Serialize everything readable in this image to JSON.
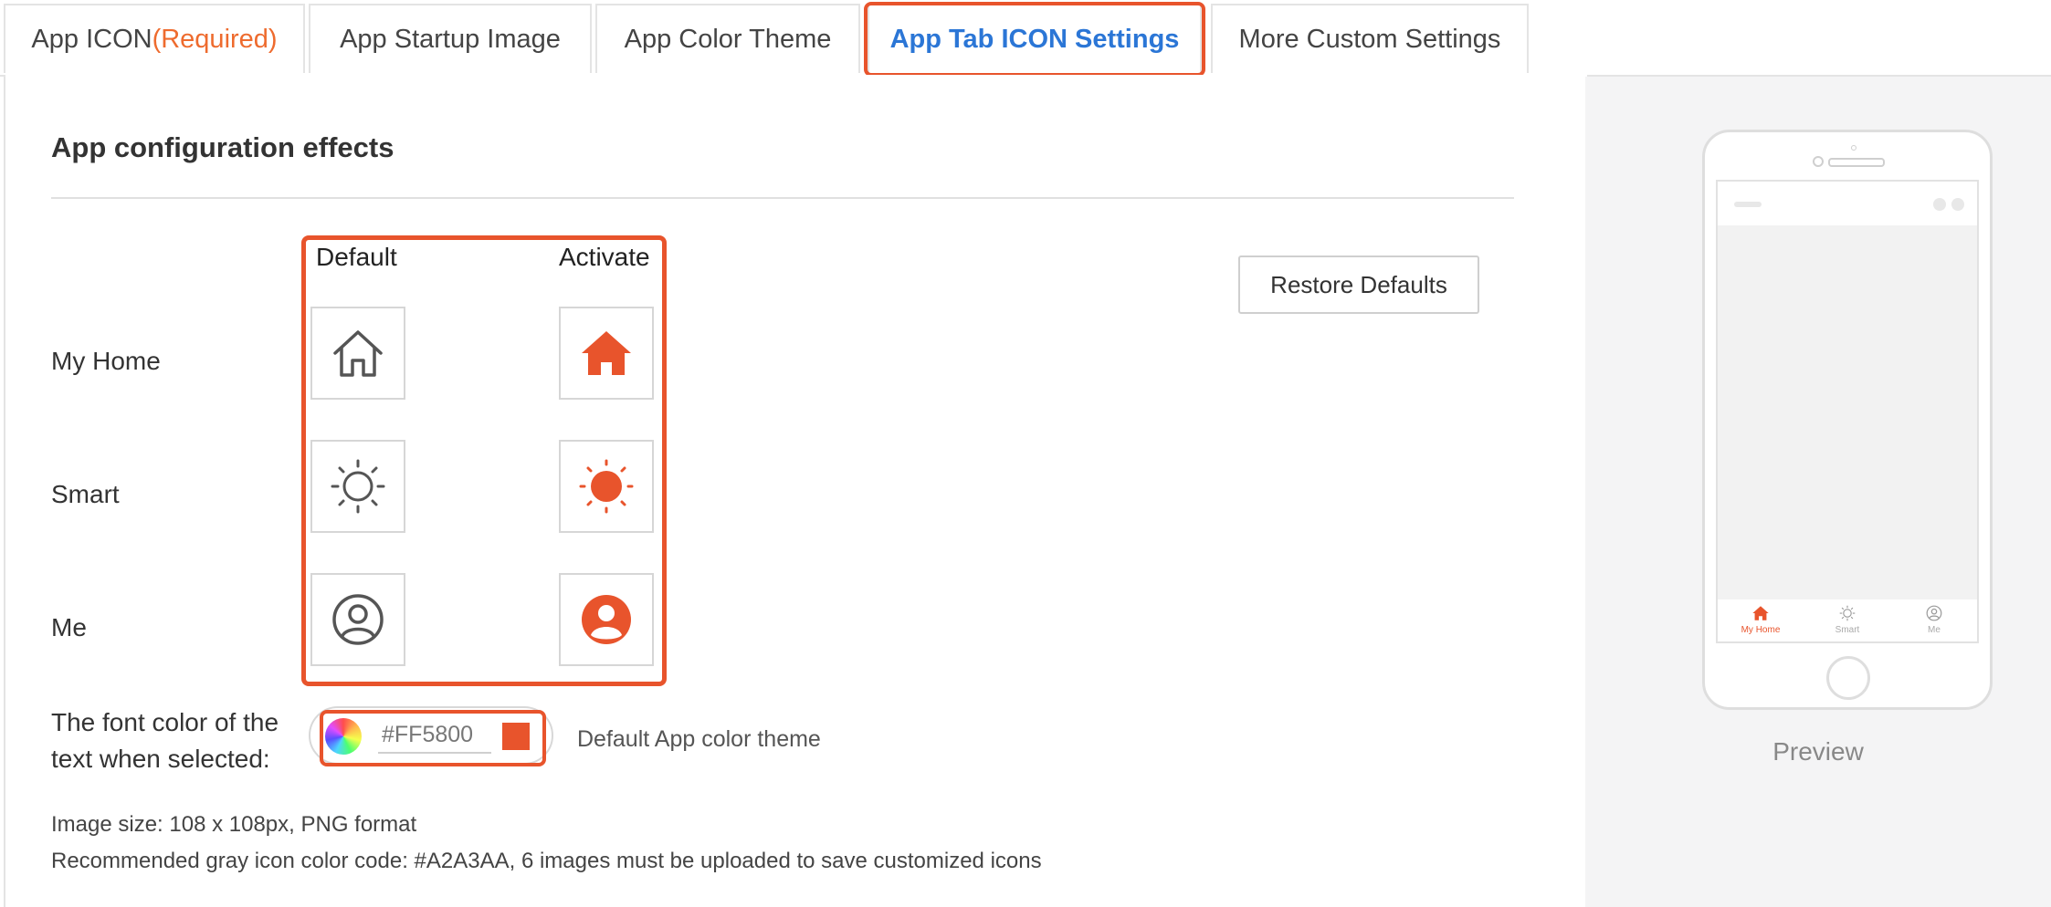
{
  "tabs": [
    {
      "label": "App ICON",
      "required": "(Required)"
    },
    {
      "label": "App Startup Image"
    },
    {
      "label": "App Color Theme"
    },
    {
      "label": "App Tab ICON Settings"
    },
    {
      "label": "More Custom Settings"
    }
  ],
  "active_tab_index": 3,
  "main": {
    "section_title": "App configuration effects",
    "col_default": "Default",
    "col_activate": "Activate",
    "rows": [
      {
        "label": "My Home",
        "default_icon": "home-outline-icon",
        "active_icon": "home-filled-icon"
      },
      {
        "label": "Smart",
        "default_icon": "sun-outline-icon",
        "active_icon": "sun-filled-icon"
      },
      {
        "label": "Me",
        "default_icon": "user-outline-icon",
        "active_icon": "user-filled-icon"
      }
    ],
    "restore_button": "Restore Defaults",
    "font_color_label_line1": "The font color of the",
    "font_color_label_line2": "text when selected:",
    "color_value": "#FF5800",
    "color_hint": "Default App color theme",
    "note_size": "Image size: 108 x 108px, PNG format",
    "note_gray": "Recommended gray icon color code: #A2A3AA, 6 images must be uploaded to save customized icons"
  },
  "preview": {
    "label": "Preview",
    "tabs": [
      "My Home",
      "Smart",
      "Me"
    ],
    "active_tab": "My Home"
  },
  "colors": {
    "accent": "#e8542c",
    "active_tab_text": "#2b76d6",
    "default_icon": "#555555",
    "preview_inactive": "#aaaaaa"
  }
}
